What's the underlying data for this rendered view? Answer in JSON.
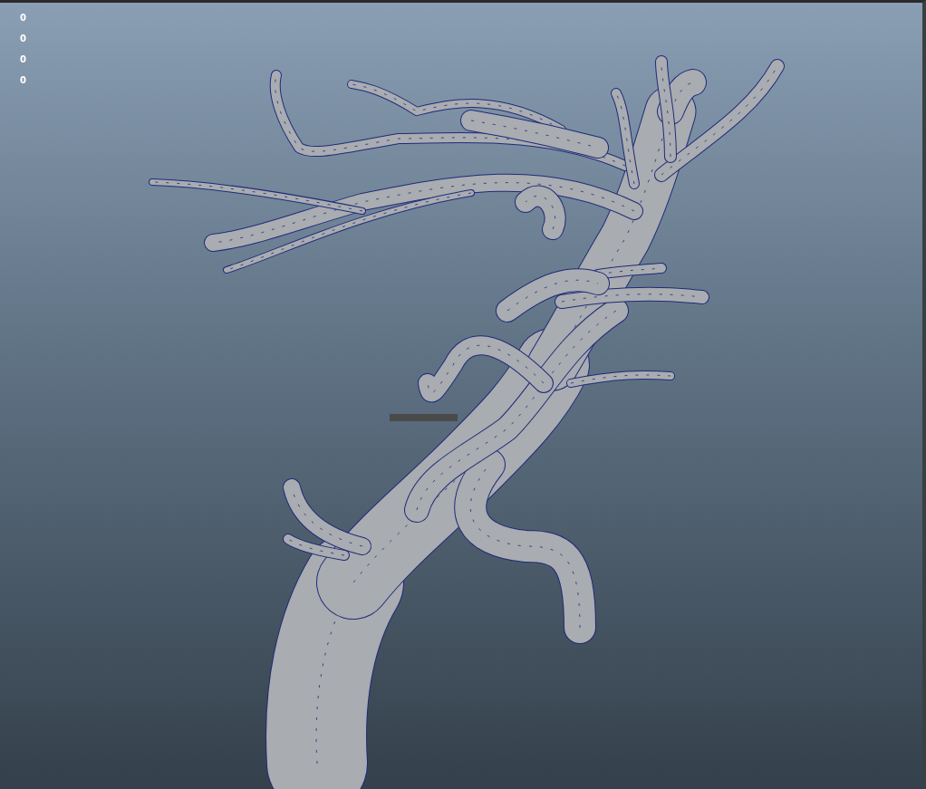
{
  "hud_values": [
    "0",
    "0",
    "0",
    "0"
  ]
}
